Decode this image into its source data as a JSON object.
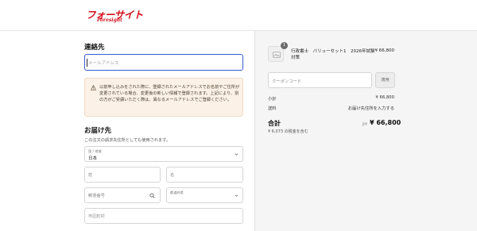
{
  "header": {
    "logo_text": "フォーサイト",
    "logo_sub": "Foresight"
  },
  "contact": {
    "title": "連絡先",
    "email_placeholder": "メールアドレス"
  },
  "notice": {
    "text": "以前申し込みをされた際に、登録されたメールアドレスでお名前やご住所が変更されている場合、変更後の新しい情報で登録されます。上記により、別の方がご受講いただく際は、異なるメールアドレスでご登録ください。"
  },
  "shipping": {
    "title": "お届け先",
    "subtitle": "この注文の請求先住所としても使用されます。",
    "country_label": "国 / 地域",
    "country_value": "日本",
    "last_name_placeholder": "姓",
    "first_name_placeholder": "名",
    "postal_placeholder": "郵便番号",
    "prefecture_label": "都道府県",
    "city_placeholder": "市区町村"
  },
  "order": {
    "item_qty": "1",
    "item_name": "行政書士　バリューセット1　2026年試験対策",
    "item_price": "¥ 66,800",
    "coupon_placeholder": "クーポンコード",
    "apply_label": "適用",
    "subtotal_label": "小計",
    "subtotal_value": "¥ 66,800",
    "shipping_label": "送料",
    "shipping_value": "お届け先住所を入力する",
    "total_label": "合計",
    "currency": "JPY",
    "total_value": "¥ 66,800",
    "tax_note": "¥ 6,073 の税金を含む"
  }
}
